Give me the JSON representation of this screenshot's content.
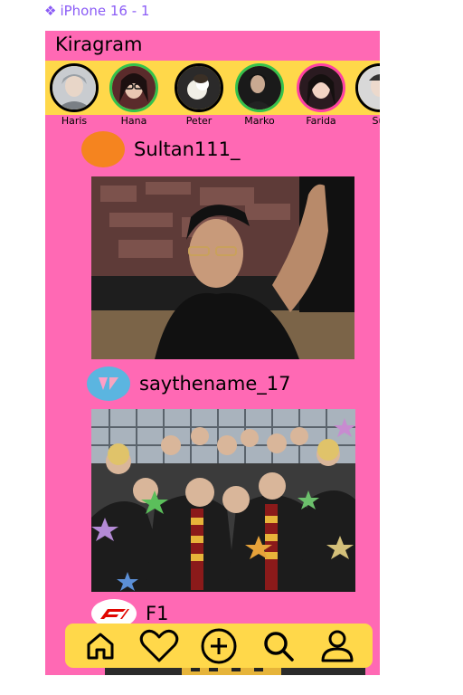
{
  "frame": {
    "icon": "component-diamond-icon",
    "glyph": "❖",
    "label": "iPhone 16 - 1"
  },
  "app": {
    "title": "Kiragram"
  },
  "stories": [
    {
      "name": "Haris",
      "ring": "none"
    },
    {
      "name": "Hana",
      "ring": "green"
    },
    {
      "name": "Peter",
      "ring": "none"
    },
    {
      "name": "Marko",
      "ring": "green"
    },
    {
      "name": "Farida",
      "ring": "pink"
    },
    {
      "name": "Sul",
      "ring": "none"
    }
  ],
  "posts": [
    {
      "username": "Sultan111_",
      "avatar_color": "#f5841f",
      "avatar_icon": "orange-circle-avatar"
    },
    {
      "username": "saythename_17",
      "avatar_color": "#5bb5e0",
      "avatar_icon": "seventeen-logo"
    },
    {
      "username": "F1",
      "avatar_color": "#ffffff",
      "avatar_icon": "f1-logo"
    }
  ],
  "nav": {
    "items": [
      {
        "icon": "home-icon"
      },
      {
        "icon": "heart-icon"
      },
      {
        "icon": "add-circle-icon"
      },
      {
        "icon": "search-icon"
      },
      {
        "icon": "profile-icon"
      }
    ]
  },
  "colors": {
    "background": "#ff69b4",
    "bar": "#ffd84a",
    "frame_label": "#8b5cf6",
    "ring_green": "#33c24d",
    "ring_pink": "#ff3fa4"
  }
}
